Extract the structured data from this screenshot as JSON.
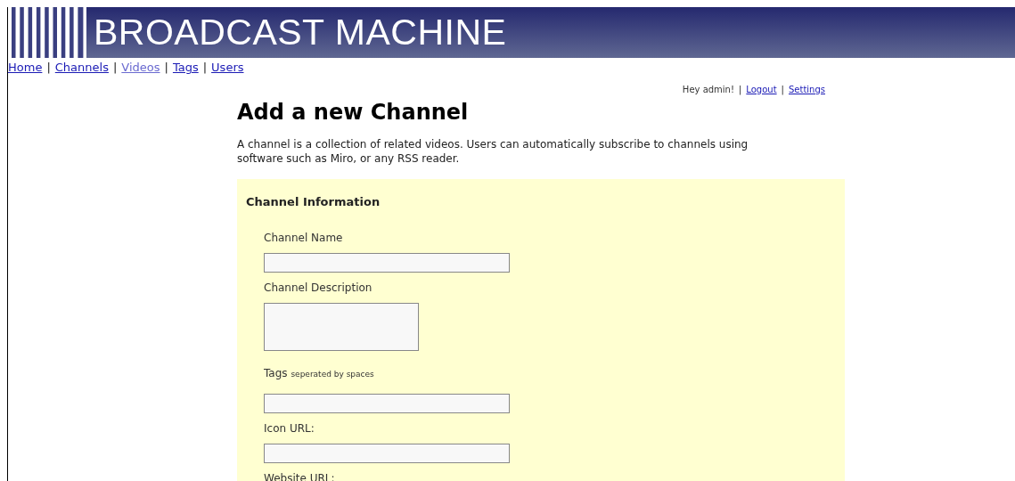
{
  "banner": {
    "title": "BROADCAST MACHINE"
  },
  "nav_separator": "|",
  "nav": [
    {
      "label": "Home",
      "visited": false
    },
    {
      "label": "Channels",
      "visited": false
    },
    {
      "label": "Videos",
      "visited": true
    },
    {
      "label": "Tags",
      "visited": false
    },
    {
      "label": "Users",
      "visited": false
    }
  ],
  "user_bar": {
    "greeting": "Hey admin!",
    "separator": "|",
    "links": [
      "Logout",
      "Settings"
    ]
  },
  "heading": "Add a new Channel",
  "intro": "A channel is a collection of related videos. Users can automatically subscribe to channels using software such as Miro, or any RSS reader.",
  "form": {
    "title": "Channel Information",
    "fields": [
      {
        "label": "Channel Name",
        "kind": "text"
      },
      {
        "label": "Channel Description",
        "kind": "textarea"
      },
      {
        "label": "Tags",
        "hint": "seperated by spaces",
        "kind": "text"
      },
      {
        "label": "Icon URL:",
        "kind": "text"
      },
      {
        "label": "Website URL:",
        "kind": "label"
      }
    ]
  }
}
